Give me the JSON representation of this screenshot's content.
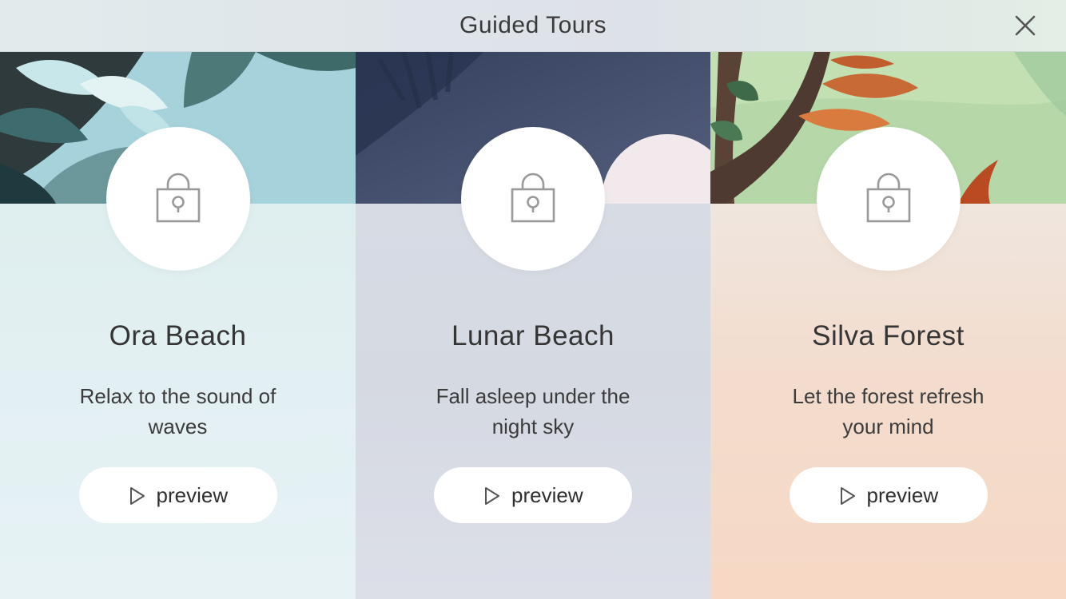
{
  "header": {
    "title": "Guided Tours",
    "close_icon": "close-icon"
  },
  "tours": [
    {
      "title": "Ora Beach",
      "description": "Relax to the sound of waves",
      "preview_label": "preview",
      "lock_icon": "lock-icon",
      "play_icon": "play-icon",
      "accent_color": "#a6d2dc"
    },
    {
      "title": "Lunar Beach",
      "description": "Fall asleep under the night sky",
      "preview_label": "preview",
      "lock_icon": "lock-icon",
      "play_icon": "play-icon",
      "accent_color": "#3f4a6a"
    },
    {
      "title": "Silva Forest",
      "description": "Let the forest refresh your mind",
      "preview_label": "preview",
      "lock_icon": "lock-icon",
      "play_icon": "play-icon",
      "accent_color": "#b6d8a8"
    }
  ]
}
